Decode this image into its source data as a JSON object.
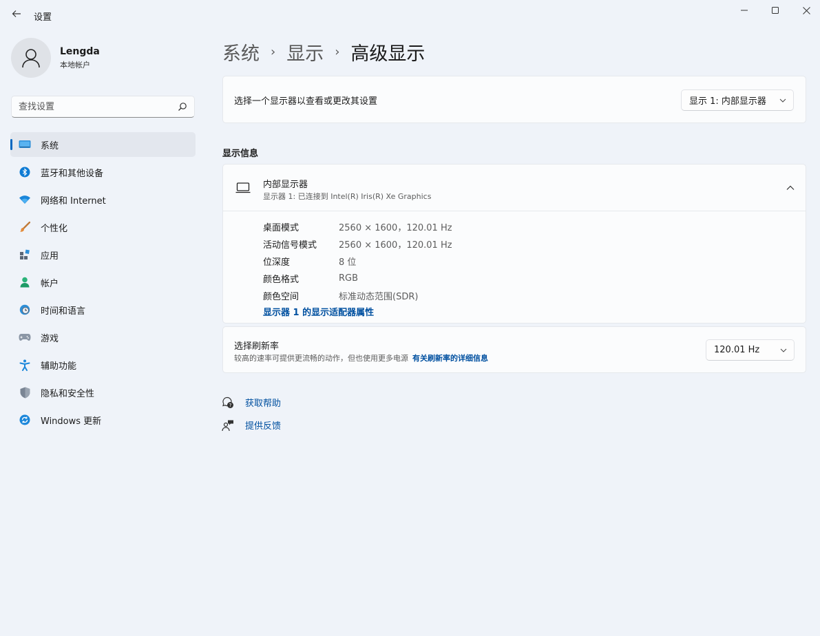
{
  "window": {
    "title": "设置",
    "back_icon": "back-arrow-icon",
    "controls": [
      "minimize-icon",
      "maximize-icon",
      "close-icon"
    ]
  },
  "profile": {
    "name": "Lengda",
    "account_type": "本地帐户"
  },
  "search": {
    "placeholder": "查找设置",
    "value": ""
  },
  "sidebar": {
    "items": [
      {
        "label": "系统",
        "icon": "system-display-icon",
        "active": true
      },
      {
        "label": "蓝牙和其他设备",
        "icon": "bluetooth-icon",
        "active": false
      },
      {
        "label": "网络和 Internet",
        "icon": "wifi-icon",
        "active": false
      },
      {
        "label": "个性化",
        "icon": "brush-icon",
        "active": false
      },
      {
        "label": "应用",
        "icon": "apps-icon",
        "active": false
      },
      {
        "label": "帐户",
        "icon": "person-icon",
        "active": false
      },
      {
        "label": "时间和语言",
        "icon": "clock-globe-icon",
        "active": false
      },
      {
        "label": "游戏",
        "icon": "gamepad-icon",
        "active": false
      },
      {
        "label": "辅助功能",
        "icon": "accessibility-icon",
        "active": false
      },
      {
        "label": "隐私和安全性",
        "icon": "shield-icon",
        "active": false
      },
      {
        "label": "Windows 更新",
        "icon": "update-icon",
        "active": false
      }
    ]
  },
  "breadcrumb": {
    "parts": [
      "系统",
      "显示"
    ],
    "current": "高级显示"
  },
  "display_select": {
    "label": "选择一个显示器以查看或更改其设置",
    "selected": "显示 1: 内部显示器"
  },
  "display_info": {
    "section_title": "显示信息",
    "title": "内部显示器",
    "subtitle": "显示器 1: 已连接到 Intel(R) Iris(R) Xe Graphics",
    "rows": [
      {
        "key": "桌面模式",
        "value": "2560 × 1600，120.01 Hz"
      },
      {
        "key": "活动信号模式",
        "value": "2560 × 1600，120.01 Hz"
      },
      {
        "key": "位深度",
        "value": "8 位"
      },
      {
        "key": "颜色格式",
        "value": "RGB"
      },
      {
        "key": "颜色空间",
        "value": "标准动态范围(SDR)"
      }
    ],
    "adapter_link": "显示器 1 的显示适配器属性"
  },
  "refresh": {
    "title": "选择刷新率",
    "description": "较高的速率可提供更流畅的动作，但也使用更多电源",
    "link": "有关刷新率的详细信息",
    "selected": "120.01 Hz"
  },
  "help": {
    "get_help": "获取帮助",
    "feedback": "提供反馈"
  },
  "colors": {
    "accent": "#0067c0",
    "link": "#0050a0",
    "background": "#eff3f9",
    "card": "#fbfcfd"
  }
}
